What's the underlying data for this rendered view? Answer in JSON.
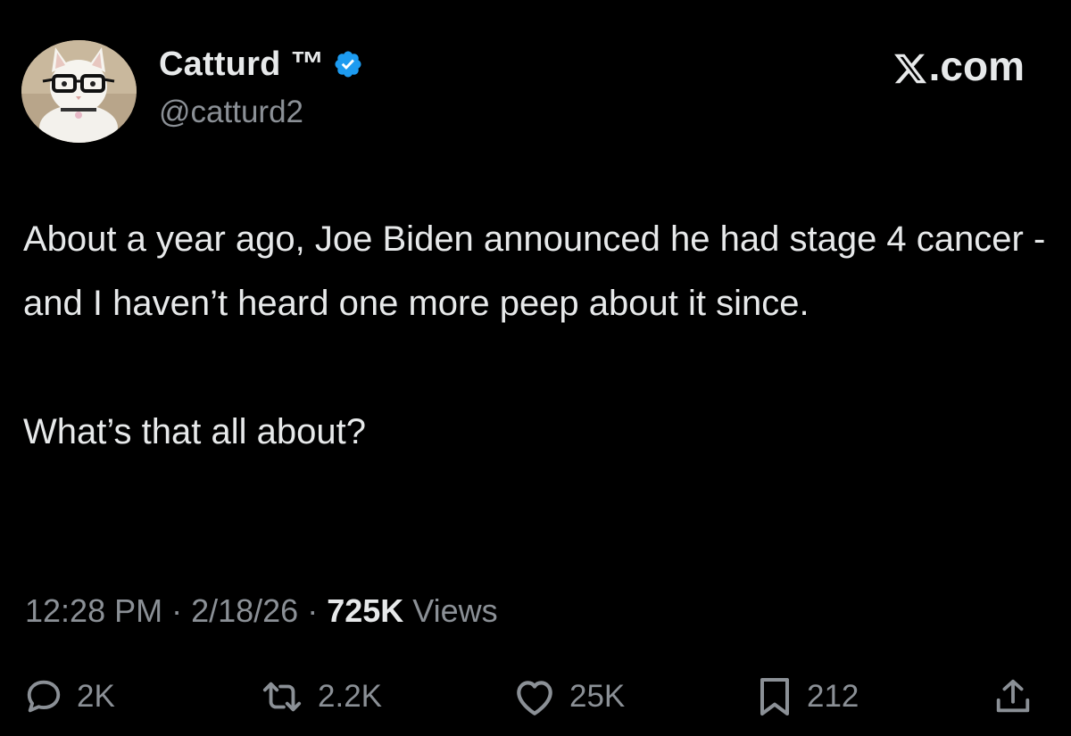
{
  "author": {
    "display_name": "Catturd ™",
    "handle": "@catturd2",
    "verified": true,
    "avatar_icon": "cat-with-glasses-avatar"
  },
  "brand": {
    "label": "X.com",
    "label_rest": ".com"
  },
  "tweet": {
    "paragraphs": [
      "About a year ago, Joe Biden announced he had stage 4 cancer - and I haven’t heard one more peep about it since.",
      "What’s that all about?"
    ]
  },
  "meta": {
    "time": "12:28 PM",
    "separator": " · ",
    "date": "2/18/26",
    "views_count": "725K",
    "views_label": " Views"
  },
  "actions": {
    "reply": {
      "icon": "reply-bubble-icon",
      "count": "2K"
    },
    "repost": {
      "icon": "repost-icon",
      "count": "2.2K"
    },
    "like": {
      "icon": "heart-icon",
      "count": "25K"
    },
    "bookmark": {
      "icon": "bookmark-icon",
      "count": "212"
    },
    "share": {
      "icon": "share-icon"
    }
  },
  "colors": {
    "background": "#000000",
    "primary_text": "#e7e9ea",
    "secondary_text": "#8b9096",
    "verified_blue": "#1d9bf0"
  }
}
